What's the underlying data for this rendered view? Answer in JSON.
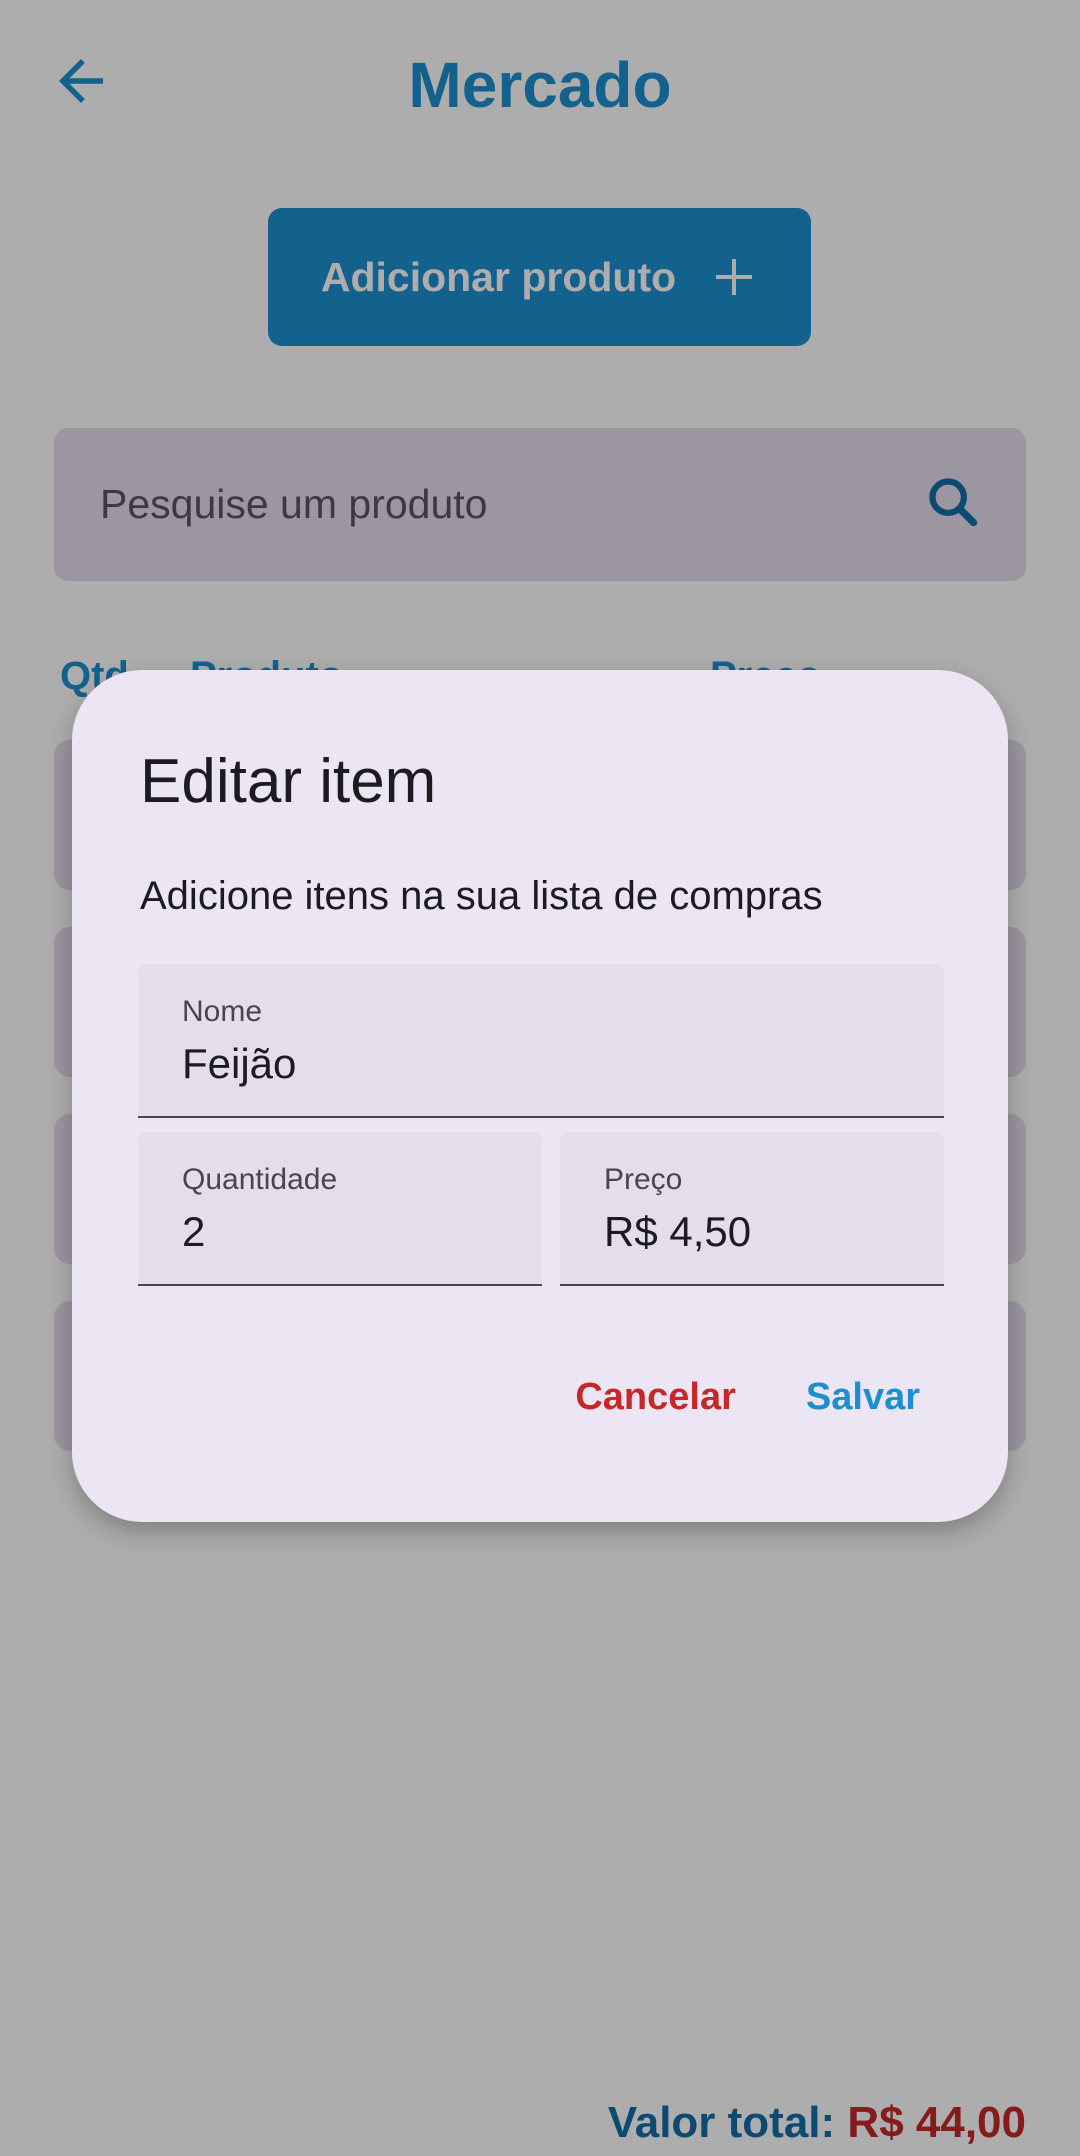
{
  "colors": {
    "primary": "#1C8FD0",
    "primary_dark": "#136EA8",
    "danger": "#C62828",
    "surface_variant": "#E6DEEC",
    "dialog_surface": "#ECE6F4"
  },
  "header": {
    "title": "Mercado",
    "back_icon": "arrow-left-icon"
  },
  "toolbar": {
    "add_product_label": "Adicionar produto",
    "add_icon": "plus-icon"
  },
  "search": {
    "placeholder": "Pesquise um produto",
    "value": "",
    "icon": "search-icon"
  },
  "list": {
    "header_qtd": "Qtd",
    "header_produto": "Produto",
    "header_preco": "Preço"
  },
  "footer": {
    "total_label": "Valor total:",
    "total_value": "R$ 44,00"
  },
  "dialog": {
    "title": "Editar item",
    "subtitle": "Adicione itens na sua lista de compras",
    "name_label": "Nome",
    "name_value": "Feijão",
    "quantity_label": "Quantidade",
    "quantity_value": "2",
    "price_label": "Preço",
    "price_value": "R$ 4,50",
    "cancel_label": "Cancelar",
    "save_label": "Salvar"
  }
}
